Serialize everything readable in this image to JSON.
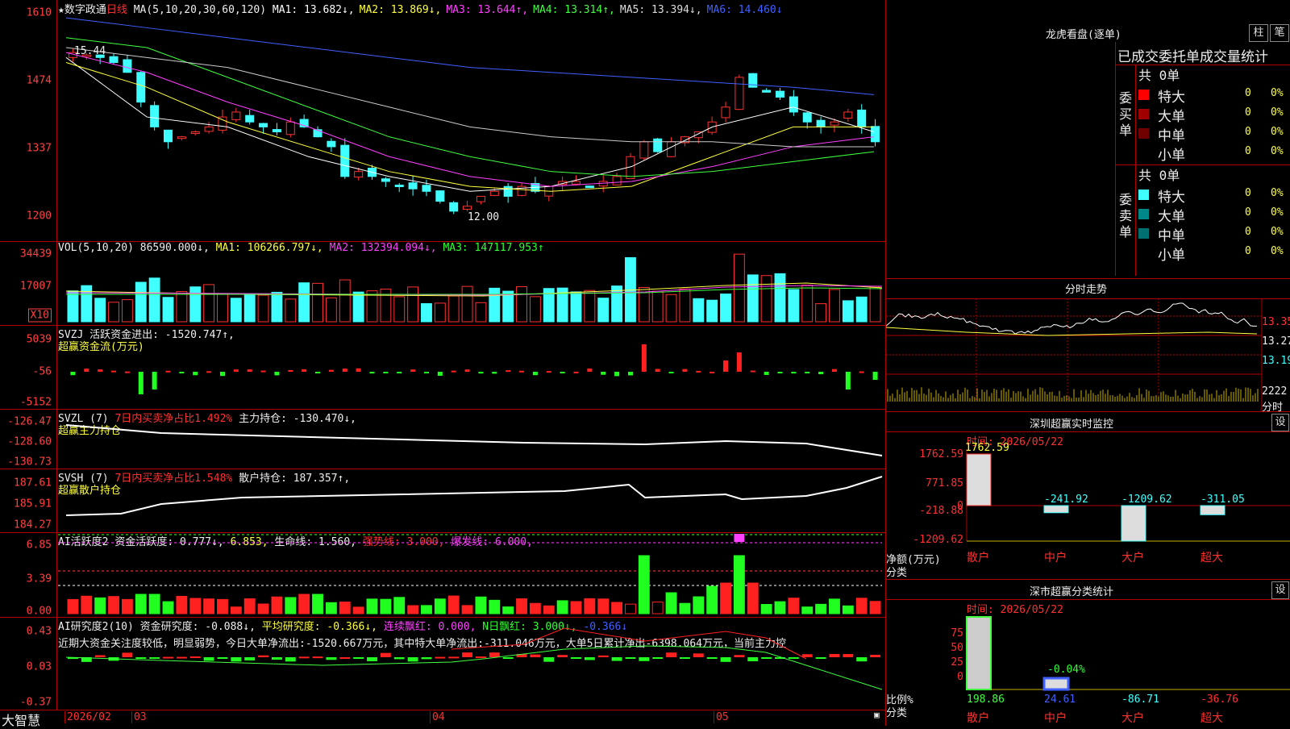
{
  "main_panel": {
    "star": "★",
    "stock_name": "数字政通",
    "period": "日线",
    "ma_label": "MA(5,10,20,30,60,120)",
    "ma_items": [
      {
        "label": "MA1: 13.682↓,",
        "color": "#ffffff"
      },
      {
        "label": "MA2: 13.869↓,",
        "color": "#ffff40"
      },
      {
        "label": "MA3: 13.644↑,",
        "color": "#ff40ff"
      },
      {
        "label": "MA4: 13.314↑,",
        "color": "#40ff40"
      },
      {
        "label": "MA5: 13.394↓,",
        "color": "#dddddd"
      },
      {
        "label": "MA6: 14.460↓",
        "color": "#4060ff"
      }
    ],
    "y_labels": [
      "1610",
      "1474",
      "1337",
      "1200"
    ],
    "high_mark": "15.44",
    "low_mark": "12.00"
  },
  "vol_panel": {
    "label": "VOL(5,10,20)",
    "value": "86590.000↓,",
    "ma1": "MA1: 106266.797↓,",
    "ma2": "MA2: 132394.094↓,",
    "ma3": "MA3: 147117.953↑",
    "y_labels": [
      "34439",
      "17007"
    ],
    "unit": "X10"
  },
  "svzj_panel": {
    "label": "SVZJ",
    "text": "活跃资金进出: -1520.747↑,",
    "sub": "超赢资金流(万元)",
    "y_labels": [
      "5039",
      "-56",
      "-5152"
    ]
  },
  "svzl_panel": {
    "label": "SVZL (7)",
    "ratio": "7日内买卖净占比1.492%",
    "hold": "主力持仓: -130.470↓,",
    "sub": "超赢主力持仓",
    "y_labels": [
      "-126.47",
      "-128.60",
      "-130.73"
    ]
  },
  "svsh_panel": {
    "label": "SVSH (7)",
    "ratio": "7日内买卖净占比1.548%",
    "hold": "散户持仓: 187.357↑,",
    "sub": "超赢散户持仓",
    "y_labels": [
      "187.61",
      "185.91",
      "184.27"
    ]
  },
  "ai_active_panel": {
    "label": "AI活跃度2",
    "fund": "资金活跃度: 0.777↓,",
    "v2": "6.853,",
    "life": "生命线: 1.560,",
    "strong": "强势线: 3.000,",
    "burst": "爆发线: 6.000,",
    "y_labels": [
      "6.85",
      "3.39",
      "0.00"
    ]
  },
  "ai_research_panel": {
    "label": "AI研究度2(10)",
    "fund": "资金研究度: -0.088↓,",
    "avg": "平均研究度: -0.366↓,",
    "red_days": "连续飘红: 0.000,",
    "n_red": "N日飘红: 3.000↓,",
    "last": "-0.366↓",
    "comment": "近期大资金关注度较低，明显弱势，今日大单净流出:-1520.667万元，其中特大单净流出:-311.046万元，大单5日累计净出-6398.064万元，当前主力控",
    "y_labels": [
      "0.43",
      "0.03",
      "-0.37"
    ]
  },
  "bottom_bar": {
    "brand": "大智慧",
    "dates": [
      "2026/02",
      "03",
      "04",
      "05"
    ]
  },
  "dragon_panel": {
    "title": "龙虎看盘(逐单)",
    "btn1": "柱",
    "btn2": "笔",
    "header": "已成交委托单成交量统计",
    "buy_label": "委买单",
    "sell_label": "委卖单",
    "buy_total": "共 0单",
    "sell_total": "共 0单",
    "buy_rows": [
      {
        "name": "特大",
        "count": "0",
        "pct": "0%",
        "color": "#ff0000"
      },
      {
        "name": "大单",
        "count": "0",
        "pct": "0%",
        "color": "#a00000"
      },
      {
        "name": "中单",
        "count": "0",
        "pct": "0%",
        "color": "#700000"
      },
      {
        "name": "小单",
        "count": "0",
        "pct": "0%",
        "color": ""
      }
    ],
    "sell_rows": [
      {
        "name": "特大",
        "count": "0",
        "pct": "0%",
        "color": "#40ffff"
      },
      {
        "name": "大单",
        "count": "0",
        "pct": "0%",
        "color": "#008888"
      },
      {
        "name": "中单",
        "count": "0",
        "pct": "0%",
        "color": "#007070"
      },
      {
        "name": "小单",
        "count": "0",
        "pct": "0%",
        "color": ""
      }
    ]
  },
  "intraday_panel": {
    "title": "分时走势",
    "prices": [
      "13.35",
      "13.27",
      "13.19"
    ],
    "vol": "2222",
    "unit": "分时"
  },
  "sz_monitor": {
    "title": "深圳超赢实时监控",
    "btn": "设",
    "time": "时间: 2026/05/22",
    "y_labels": [
      "1762.59",
      "771.85",
      "0",
      "-218.88",
      "-1209.62"
    ],
    "axis_title": "净额(万元)",
    "axis_sub": "分类",
    "categories": [
      "散户",
      "中户",
      "大户",
      "超大"
    ],
    "values": [
      "1762.59",
      "-241.92",
      "-1209.62",
      "-311.05"
    ]
  },
  "sz_class": {
    "title": "深市超赢分类统计",
    "btn": "设",
    "time": "时间: 2026/05/22",
    "y_labels": [
      "75",
      "50",
      "25",
      "0"
    ],
    "axis_title": "比例%",
    "axis_sub": "分类",
    "categories": [
      "散户",
      "中户",
      "大户",
      "超大"
    ],
    "values": [
      "198.86",
      "24.61",
      "-86.71",
      "-36.76"
    ],
    "mid_label": "-0.04%"
  }
}
